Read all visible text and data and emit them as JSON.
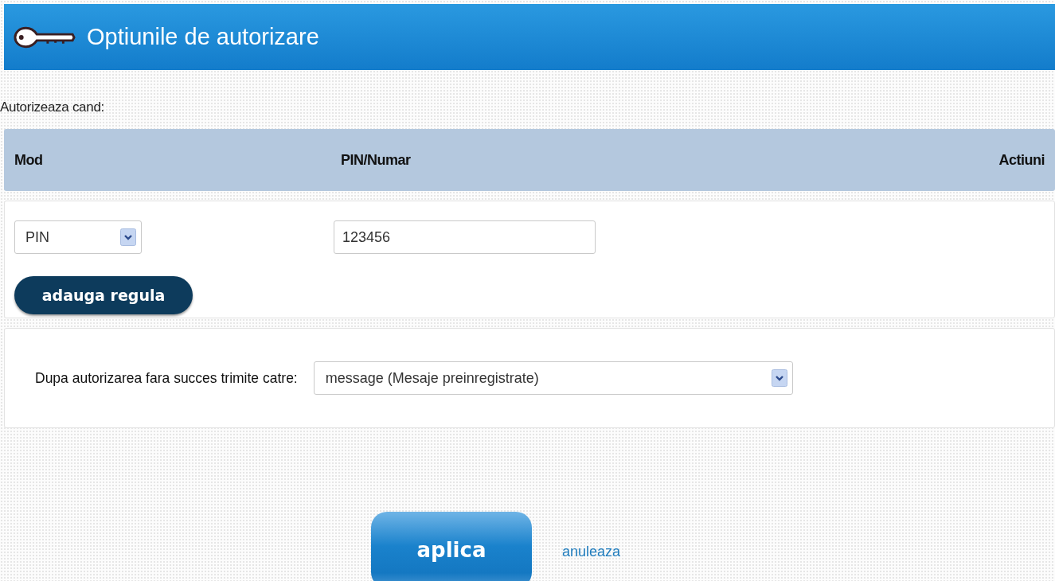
{
  "header": {
    "title": "Optiunile de autorizare"
  },
  "section_label": "Autorizeaza cand:",
  "table": {
    "columns": [
      "Mod",
      "PIN/Numar",
      "Actiuni"
    ],
    "rows": [
      {
        "mode": "PIN",
        "value": "123456"
      }
    ]
  },
  "add_button": "adauga regula",
  "fallback": {
    "label": "Dupa autorizarea fara succes trimite catre:",
    "value": "message (Mesaje preinregistrate)"
  },
  "buttons": [
    {
      "kind": "primary",
      "label": "aplica"
    },
    {
      "kind": "link",
      "label": "anuleaza"
    }
  ]
}
